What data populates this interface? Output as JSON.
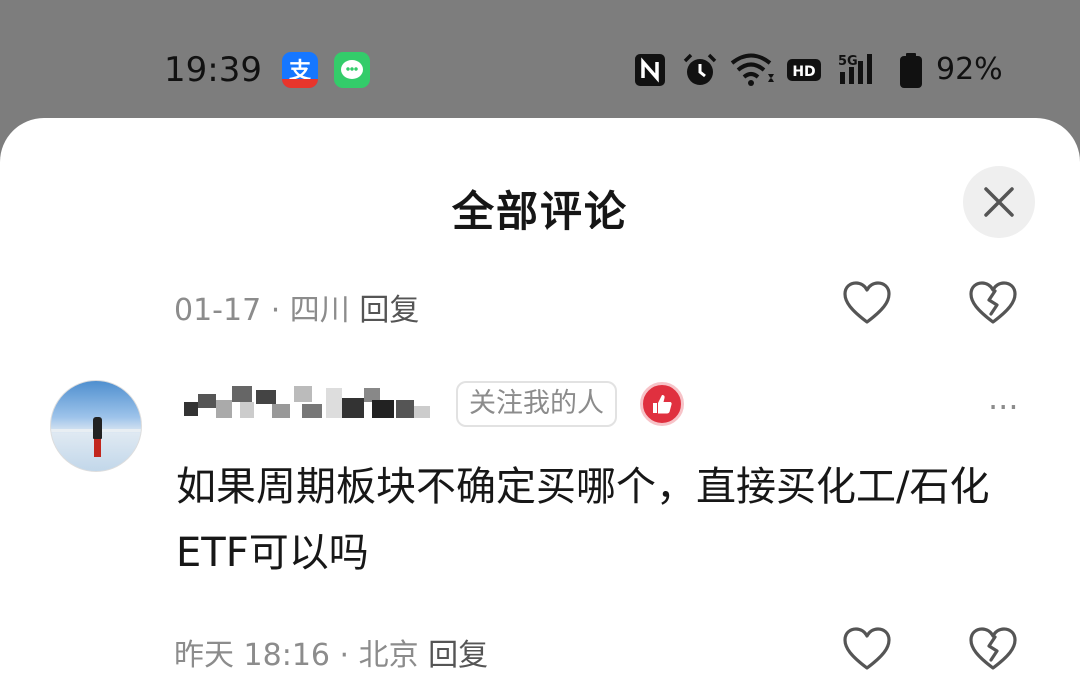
{
  "status_bar": {
    "time": "19:39",
    "battery": "92%",
    "icons": [
      "alipay-app-icon",
      "messages-app-icon",
      "nfc-icon",
      "alarm-icon",
      "wifi-icon",
      "hd-icon",
      "5g-signal-icon",
      "battery-icon"
    ],
    "alipay_glyph": "支"
  },
  "sheet": {
    "title": "全部评论",
    "close_icon": "close-icon"
  },
  "comments": [
    {
      "meta_date": "01-17 · 四川",
      "reply_label": "回复"
    },
    {
      "tag": "关注我的人",
      "text": "如果周期板块不确定买哪个，直接买化工/石化ETF可以吗",
      "meta_date": "昨天 18:16 · 北京",
      "reply_label": "回复",
      "more_label": "···"
    }
  ],
  "colors": {
    "accent_red": "#e0303f",
    "sheet_bg": "#ffffff",
    "backdrop": "#7d7d7d",
    "meta_text": "#8c8c8c"
  }
}
